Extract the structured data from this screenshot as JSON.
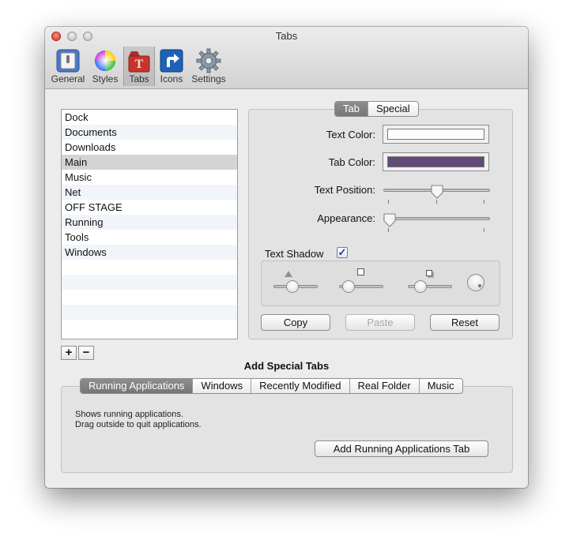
{
  "window": {
    "title": "Tabs"
  },
  "toolbar": {
    "items": [
      {
        "label": "General",
        "icon": "switch-icon"
      },
      {
        "label": "Styles",
        "icon": "color-wheel-icon"
      },
      {
        "label": "Tabs",
        "icon": "tabs-icon"
      },
      {
        "label": "Icons",
        "icon": "alias-arrow-icon"
      },
      {
        "label": "Settings",
        "icon": "gear-icon"
      }
    ],
    "selected": "Tabs"
  },
  "tab_list": {
    "items": [
      "Dock",
      "Documents",
      "Downloads",
      "Main",
      "Music",
      "Net",
      "OFF STAGE",
      "Running",
      "Tools",
      "Windows"
    ],
    "selected": "Main",
    "add_label": "+",
    "remove_label": "−"
  },
  "style_panel": {
    "segments": [
      "Tab",
      "Special"
    ],
    "selected_segment": "Tab",
    "text_color_label": "Text Color:",
    "text_color": "#ffffff",
    "tab_color_label": "Tab Color:",
    "tab_color": "#614b78",
    "text_position_label": "Text Position:",
    "text_position_value": 0.5,
    "appearance_label": "Appearance:",
    "appearance_value": 0.0,
    "text_shadow_label": "Text Shadow",
    "text_shadow_checked": true,
    "checkmark": "✓",
    "shadow_sliders": [
      0.4,
      0.1,
      0.2
    ],
    "copy_label": "Copy",
    "paste_label": "Paste",
    "reset_label": "Reset"
  },
  "special_tabs": {
    "title": "Add Special Tabs",
    "segments": [
      "Running Applications",
      "Windows",
      "Recently Modified",
      "Real Folder",
      "Music"
    ],
    "selected": "Running Applications",
    "description_line1": "Shows running applications.",
    "description_line2": "Drag outside to quit applications.",
    "add_button_label": "Add Running Applications Tab"
  }
}
